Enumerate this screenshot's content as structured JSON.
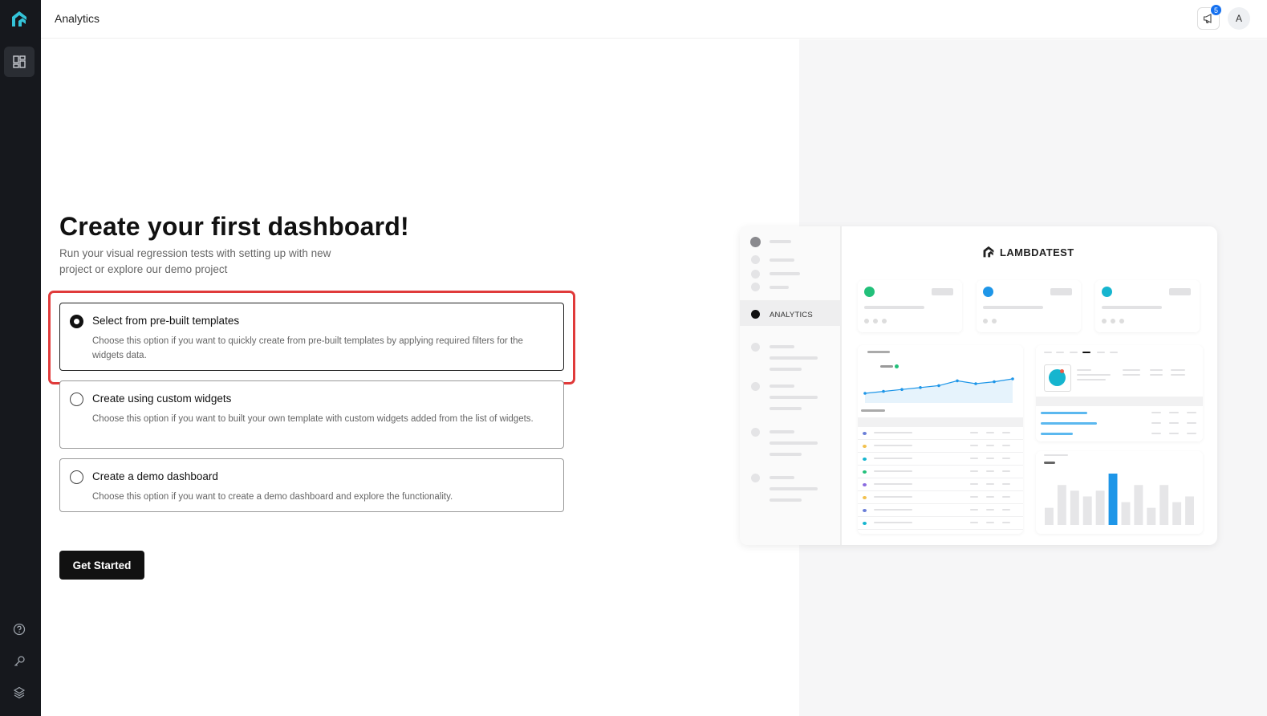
{
  "app": {
    "title": "Analytics",
    "notification_count": "5",
    "avatar_initial": "A"
  },
  "main": {
    "heading": "Create your first dashboard!",
    "subtext": "Run your visual regression tests with setting up with new project or explore our demo project",
    "options": [
      {
        "title": "Select from pre-built templates",
        "description": "Choose this option if you want to quickly create from pre-built templates by applying required filters for the widgets data.",
        "selected": true
      },
      {
        "title": "Create using custom widgets",
        "description": "Choose this option if you want to built your own template with custom widgets added from the list of widgets.",
        "selected": false
      },
      {
        "title": "Create a demo dashboard",
        "description": "Choose this option if you want to create a demo dashboard and explore the functionality.",
        "selected": false
      }
    ],
    "cta_label": "Get Started"
  },
  "preview": {
    "brand": "LAMBDATEST",
    "sidebar_active_label": "ANALYTICS",
    "bar_chart_values": [
      3,
      7,
      6,
      5,
      6,
      9,
      4,
      7,
      3,
      7,
      4,
      5
    ],
    "line_chart_values": [
      2,
      2.4,
      2.8,
      3.2,
      3.6,
      4.6,
      4.0,
      4.4,
      5.0
    ]
  },
  "colors": {
    "accent": "#1570ef",
    "rail": "#16181d",
    "highlight": "#e03a3a",
    "green": "#22c07a",
    "blue": "#1e96e8",
    "teal": "#16b5cf"
  }
}
